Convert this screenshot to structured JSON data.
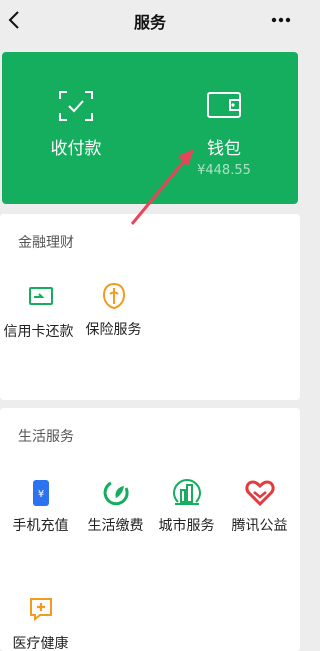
{
  "header": {
    "title": "服务"
  },
  "wallet_card": {
    "pay_label": "收付款",
    "wallet_label": "钱包",
    "balance": "¥448.55"
  },
  "finance": {
    "title": "金融理财",
    "items": [
      {
        "label": "信用卡还款",
        "icon": "credit-card-icon"
      },
      {
        "label": "保险服务",
        "icon": "insurance-icon"
      }
    ]
  },
  "life": {
    "title": "生活服务",
    "items": [
      {
        "label": "手机充值",
        "icon": "phone-recharge-icon"
      },
      {
        "label": "生活缴费",
        "icon": "utility-payment-icon"
      },
      {
        "label": "城市服务",
        "icon": "city-service-icon"
      },
      {
        "label": "腾讯公益",
        "icon": "charity-icon"
      },
      {
        "label": "医疗健康",
        "icon": "medical-icon"
      }
    ]
  },
  "colors": {
    "brand_green": "#15ad5e",
    "annotation_arrow": "#e8455a",
    "insurance_orange": "#f49a1c",
    "phone_blue": "#2b73f0",
    "charity_red": "#e6393c"
  }
}
